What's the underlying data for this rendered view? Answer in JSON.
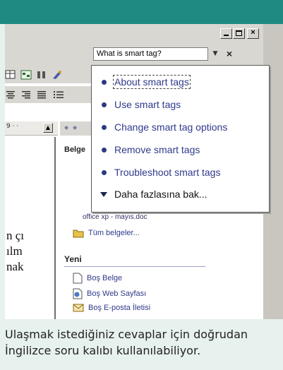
{
  "ask_box": {
    "value": "What is smart tag?"
  },
  "menu": {
    "items": [
      {
        "label": "About smart tags"
      },
      {
        "label": "Use smart tags"
      },
      {
        "label": "Change smart tag options"
      },
      {
        "label": "Remove smart tags"
      },
      {
        "label": "Troubleshoot smart tags"
      }
    ],
    "more_label": "Daha fazlasına bak..."
  },
  "document": {
    "ruler_label": "9 · ·",
    "lines": [
      "n çı",
      "ılm",
      "nak"
    ]
  },
  "task_pane": {
    "belge_label": "Belge",
    "recent_file": "office xp - mayıs.doc",
    "all_docs_link": "Tüm belgeler...",
    "new_heading": "Yeni",
    "new_items": [
      {
        "label": "Boş Belge",
        "icon": "blank-document-icon"
      },
      {
        "label": "Boş Web Sayfası",
        "icon": "web-page-icon"
      },
      {
        "label": "Boş E-posta İletisi",
        "icon": "email-message-icon"
      }
    ]
  },
  "caption": "Ulaşmak istediğiniz cevaplar için doğrudan\nİngilizce soru kalıbı kullanılabiliyor.",
  "colors": {
    "frame_teal": "#1f8a82",
    "link_blue": "#2f3a8a",
    "chrome_grey": "#d9d7d2"
  }
}
